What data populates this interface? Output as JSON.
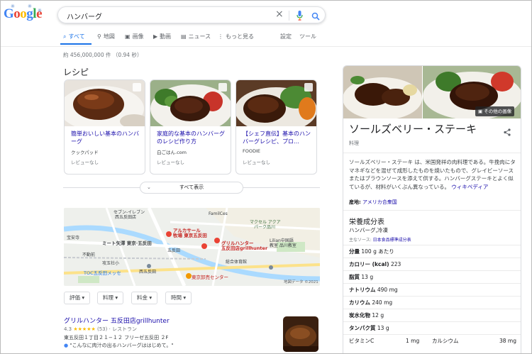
{
  "logo": "Google",
  "search": {
    "query": "ハンバーグ"
  },
  "tabs": [
    {
      "label": "すべて",
      "icon": "search-icon"
    },
    {
      "label": "地図",
      "icon": "map-pin-icon"
    },
    {
      "label": "画像",
      "icon": "image-icon"
    },
    {
      "label": "動画",
      "icon": "video-icon"
    },
    {
      "label": "ニュース",
      "icon": "news-icon"
    },
    {
      "label": "もっと見る",
      "icon": "more-vert-icon"
    },
    {
      "label": "設定"
    },
    {
      "label": "ツール"
    }
  ],
  "result_stats": "約 456,000,000 件 （0.94 秒）",
  "recipes": {
    "section_title": "レシピ",
    "items": [
      {
        "title": "簡単おいしい基本のハンバーグ",
        "source": "クックパッド",
        "reviews": "レビューなし"
      },
      {
        "title": "家庭的な基本のハンバーグのレシピ作り方",
        "source": "白ごはん.com",
        "reviews": "レビューなし"
      },
      {
        "title": "【シェフ直伝】基本のハンバーグレシピ、プロ…",
        "source": "FOODIE",
        "reviews": "レビューなし"
      }
    ],
    "show_all": "すべて表示"
  },
  "map": {
    "labels": {
      "seven": "セブン-イレブン\n西五反田店",
      "famil": "FamilCes",
      "aqua": "マクセル アクア\nパーク品川",
      "alcasar": "アルカサール\n牧場 東京五反田",
      "grill": "グリルハンター\n五反田店grillhunter",
      "mito": "ミート矢澤 東京·五反田",
      "gotanda": "五反田",
      "lilian": "Lilian中国語\n教室 品川教室",
      "kokusai": "総合体育館",
      "hoanji": "宝安寺",
      "fudomae": "不動前",
      "kosan": "攻玉社小",
      "toc": "TOC五反田メッセ",
      "nishigo": "西五反田",
      "tokyo_cd": "東京卸売センター",
      "mapdata": "地図データ ©2021"
    }
  },
  "chips": [
    "評価",
    "料理",
    "料金",
    "時間"
  ],
  "local_result": {
    "name": "グリルハンター 五反田店grillhunter",
    "rating": "4.3",
    "stars": "★★★★★",
    "count": "(53)",
    "category": "レストラン",
    "address": "東五反田１丁目２１−１２ フリーゼ五反田 ２F",
    "quote": "\"こんなに肉汁の出るハンバーグははじめて。\""
  },
  "knowledge_panel": {
    "more_images": "その他の画像",
    "title": "ソールズベリー・ステーキ",
    "subtitle": "料理",
    "description": "ソールズベリー・ステーキ は、米国発祥の肉料理である。牛挽肉にタマネギなどを混ぜて成形したものを焼いたもので、グレイビーソースまたはブラウンソースを添えて供する。ハンバーグステーキとよく似ているが、材料がいくぶん異なっている。",
    "wiki": "ウィキペディア",
    "origin_label": "産地:",
    "origin_value": "アメリカ合衆国",
    "nutrition_title": "栄養成分表",
    "nutrition_sub": "ハンバーグ,冷凍",
    "nutrition_src_label": "主なソース:",
    "nutrition_src": "日本食品標準成分表",
    "rows": [
      {
        "label": "分量",
        "value": "100 g あたり"
      },
      {
        "label": "カロリー (kcal)",
        "value": "223"
      },
      {
        "label": "脂質",
        "value": "13 g"
      },
      {
        "label": "ナトリウム",
        "value": "490 mg"
      },
      {
        "label": "カリウム",
        "value": "240 mg"
      },
      {
        "label": "炭水化物",
        "value": "12 g"
      },
      {
        "label": "タンパク質",
        "value": "13 g"
      }
    ],
    "last_row": {
      "a": "ビタミンC",
      "b": "1 mg",
      "c": "カルシウム",
      "d": "38 mg"
    }
  }
}
